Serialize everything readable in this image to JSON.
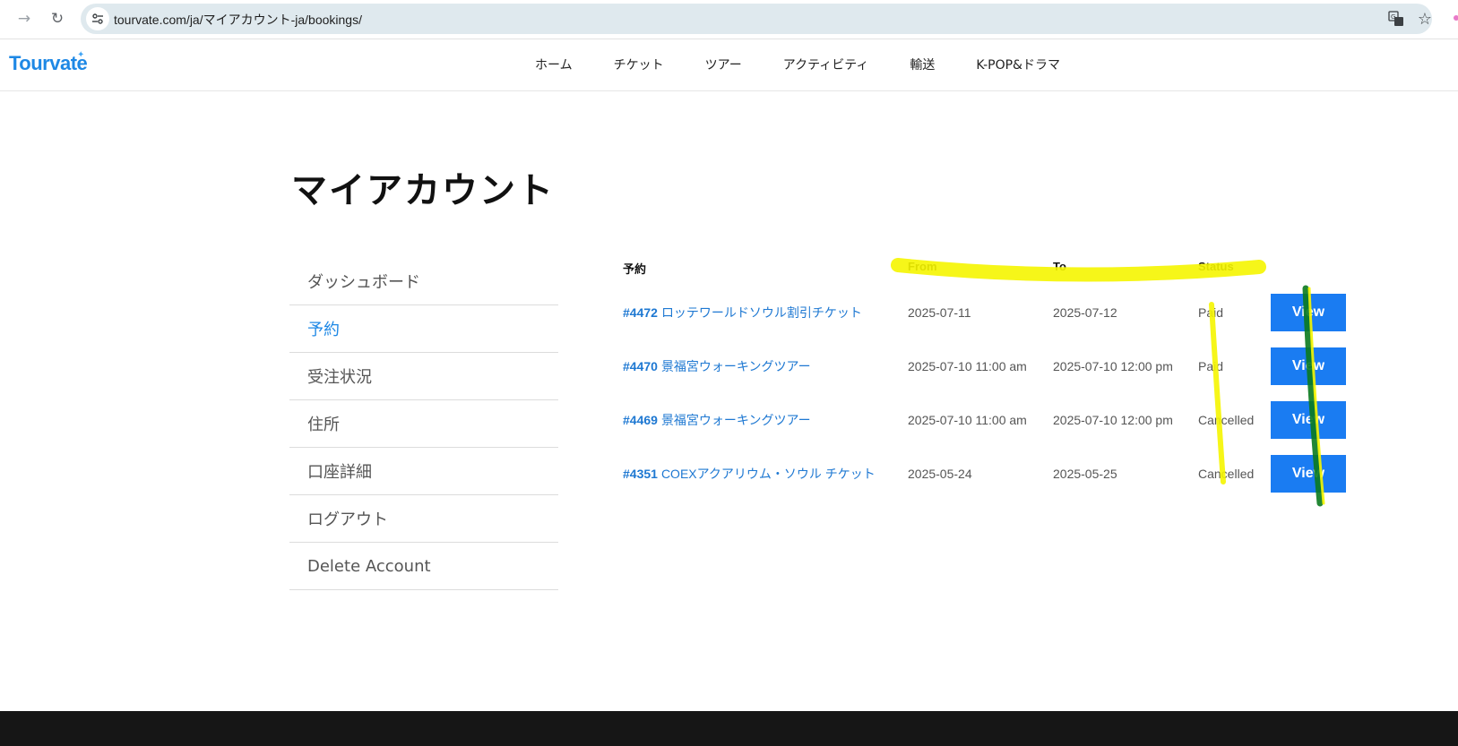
{
  "browser": {
    "url": "tourvate.com/ja/マイアカウント-ja/bookings/",
    "forward_icon": "→",
    "reload_icon": "↻",
    "translate_icon": "⇄",
    "star_icon": "☆",
    "site_info_icon": "⚙"
  },
  "site": {
    "logo": "Tourvate",
    "nav": [
      "ホーム",
      "チケット",
      "ツアー",
      "アクティビティ",
      "輸送",
      "K-POP&ドラマ"
    ]
  },
  "page": {
    "title": "マイアカウント"
  },
  "account_menu": [
    {
      "label": "ダッシュボード",
      "active": false
    },
    {
      "label": "予約",
      "active": true
    },
    {
      "label": "受注状況",
      "active": false
    },
    {
      "label": "住所",
      "active": false
    },
    {
      "label": "口座詳細",
      "active": false
    },
    {
      "label": "ログアウト",
      "active": false
    },
    {
      "label": "Delete Account",
      "active": false
    }
  ],
  "bookings": {
    "headers": {
      "booking": "予約",
      "from": "From",
      "to": "To",
      "status": "Status"
    },
    "rows": [
      {
        "number": "#4472",
        "name": "ロッテワールドソウル割引チケット",
        "from": "2025-07-11",
        "to": "2025-07-12",
        "status": "Paid",
        "action": "View"
      },
      {
        "number": "#4470",
        "name": "景福宮ウォーキングツアー",
        "from": "2025-07-10 11:00 am",
        "to": "2025-07-10 12:00 pm",
        "status": "Paid",
        "action": "View"
      },
      {
        "number": "#4469",
        "name": "景福宮ウォーキングツアー",
        "from": "2025-07-10 11:00 am",
        "to": "2025-07-10 12:00 pm",
        "status": "Cancelled",
        "action": "View"
      },
      {
        "number": "#4351",
        "name": "COEXアクアリウム・ソウル チケット",
        "from": "2025-05-24",
        "to": "2025-05-25",
        "status": "Cancelled",
        "action": "View"
      }
    ]
  },
  "colors": {
    "accent": "#1a7cf2",
    "link": "#1e78d2",
    "highlight_yellow": "#f5f500",
    "highlight_green": "#0a7a1e",
    "footer": "#161616"
  }
}
